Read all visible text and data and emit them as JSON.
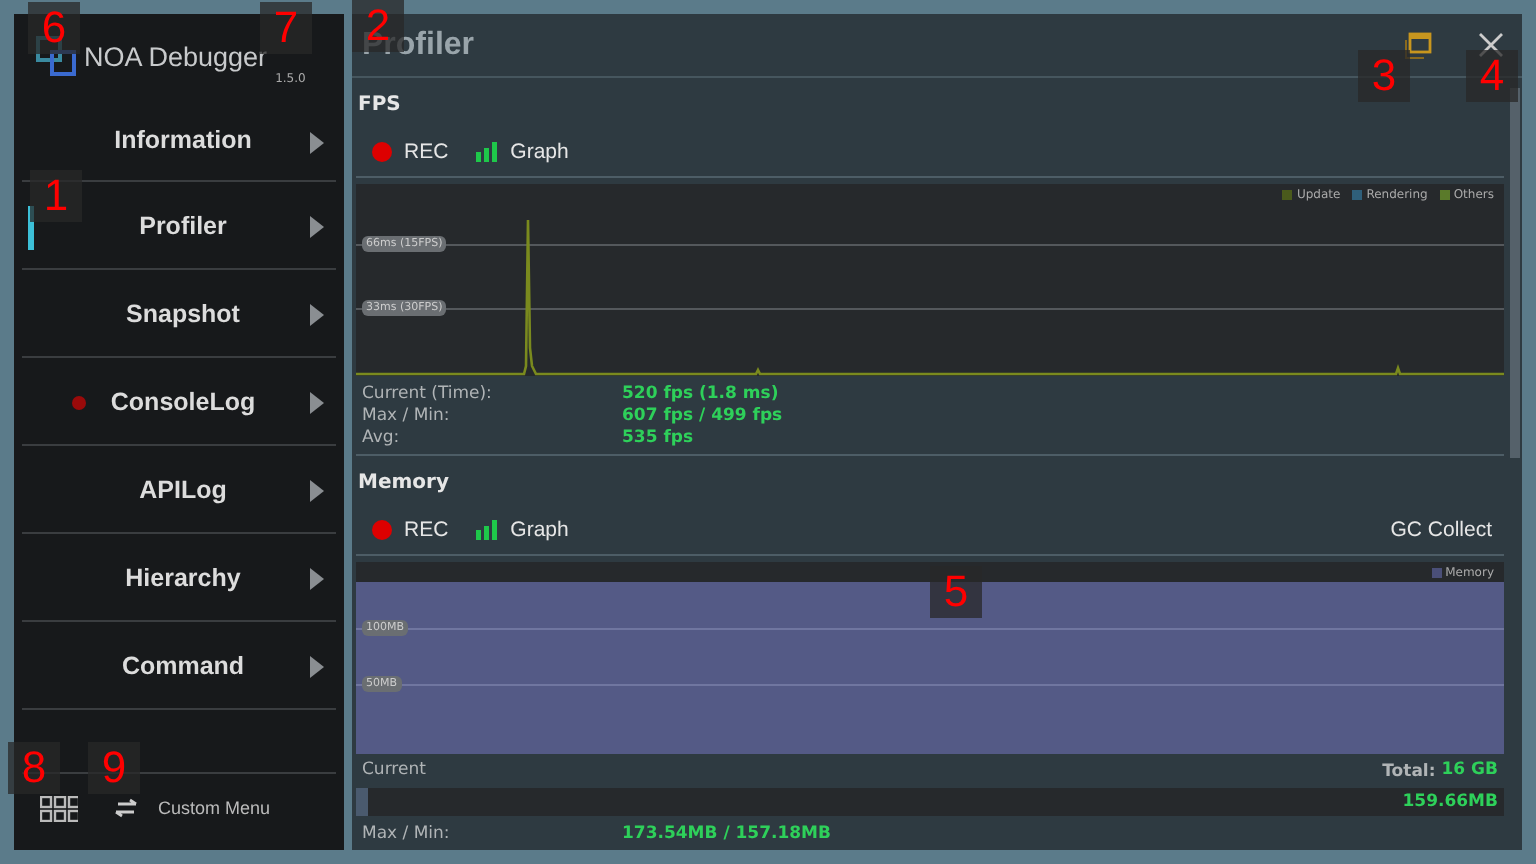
{
  "app": {
    "name": "NOA Debugger",
    "version": "1.5.0"
  },
  "sidebar": {
    "items": [
      {
        "label": "Information",
        "selected": false,
        "notification": false
      },
      {
        "label": "Profiler",
        "selected": true,
        "notification": false
      },
      {
        "label": "Snapshot",
        "selected": false,
        "notification": false
      },
      {
        "label": "ConsoleLog",
        "selected": false,
        "notification": true
      },
      {
        "label": "APILog",
        "selected": false,
        "notification": false
      },
      {
        "label": "Hierarchy",
        "selected": false,
        "notification": false
      },
      {
        "label": "Command",
        "selected": false,
        "notification": false
      }
    ],
    "custom_menu": "Custom Menu"
  },
  "page_title": "Profiler",
  "fps": {
    "title": "FPS",
    "rec": "REC",
    "graph": "Graph",
    "legend": [
      {
        "label": "Update",
        "color": "#4a5a1c"
      },
      {
        "label": "Rendering",
        "color": "#2f5f7a"
      },
      {
        "label": "Others",
        "color": "#5a7a2a"
      }
    ],
    "gridlines": [
      "66ms (15FPS)",
      "33ms (30FPS)"
    ],
    "stats": [
      {
        "label": "Current (Time):",
        "value": "520 fps (1.8 ms)"
      },
      {
        "label": "Max / Min:",
        "value": "607 fps / 499 fps"
      },
      {
        "label": "Avg:",
        "value": "535 fps"
      }
    ]
  },
  "memory": {
    "title": "Memory",
    "rec": "REC",
    "graph": "Graph",
    "gc_collect": "GC Collect",
    "legend": [
      {
        "label": "Memory",
        "color": "#4a4f78"
      }
    ],
    "gridlines": [
      "100MB",
      "50MB"
    ],
    "current_label": "Current",
    "total_label": "Total:",
    "total_value": "16 GB",
    "usage": {
      "level": 0.01,
      "reading": "159.66MB"
    },
    "stats": [
      {
        "label": "Max / Min:",
        "value": "173.54MB / 157.18MB"
      }
    ]
  },
  "callouts": [
    "6",
    "7",
    "2",
    "3",
    "4",
    "1",
    "5",
    "8",
    "9"
  ]
}
